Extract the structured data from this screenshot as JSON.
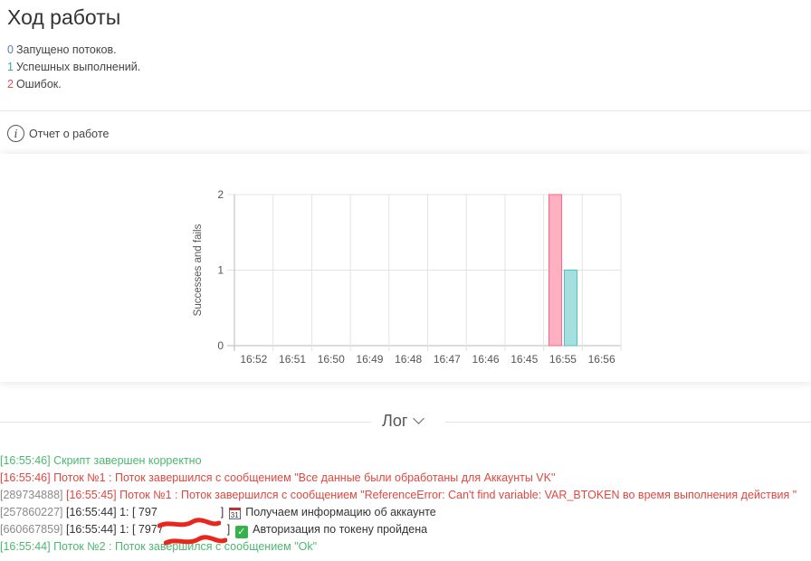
{
  "header": {
    "title": "Ход работы",
    "stats": [
      {
        "value": "0",
        "label": "Запущено потоков.",
        "color": "#5b7fb8"
      },
      {
        "value": "1",
        "label": "Успешных выполнений.",
        "color": "#3aa8a0"
      },
      {
        "value": "2",
        "label": "Ошибок.",
        "color": "#d9534f"
      }
    ],
    "report_link": "Отчет о работе"
  },
  "chart_data": {
    "type": "bar",
    "categories": [
      "16:52",
      "16:51",
      "16:50",
      "16:49",
      "16:48",
      "16:47",
      "16:46",
      "16:45",
      "16:55",
      "16:56"
    ],
    "series": [
      {
        "values": [
          0,
          0,
          0,
          0,
          0,
          0,
          0,
          0,
          2,
          0
        ],
        "color": "#ffb1c1",
        "stroke": "#ff6384"
      },
      {
        "values": [
          0,
          0,
          0,
          0,
          0,
          0,
          0,
          0,
          1,
          0
        ],
        "color": "#a5dfdf",
        "stroke": "#4bc0c0"
      }
    ],
    "ylabel": "Successes and fails",
    "yticks": [
      "0",
      "1",
      "2"
    ],
    "ylim": [
      0,
      2
    ],
    "grid": true
  },
  "log": {
    "title": "Лог",
    "entries": [
      {
        "parts": [
          {
            "text": "[16:55:46] Скрипт завершен корректно",
            "cls": "c-green"
          }
        ]
      },
      {
        "parts": [
          {
            "text": "[16:55:46] Поток №1 : Поток завершился с сообщением \"Все данные были обработаны для Аккаунты VK\"",
            "cls": "c-red"
          }
        ]
      },
      {
        "parts": [
          {
            "text": "[289734888] ",
            "cls": "c-gray"
          },
          {
            "text": "[16:55:45] Поток №1 : Поток завершился с сообщением \"ReferenceError: Can't find variable: VAR_BTOKEN во время выполнения действия \"",
            "cls": "c-red"
          }
        ]
      },
      {
        "parts": [
          {
            "text": "[257860227] ",
            "cls": "c-gray"
          },
          {
            "text": "[16:55:44] 1: [ 797",
            "cls": "c-dark"
          },
          {
            "redact": true,
            "text": "0000000 ",
            "cls": "c-dark"
          },
          {
            "text": "] ",
            "cls": "c-dark"
          },
          {
            "icon": "calendar-icon",
            "text": "31"
          },
          {
            "text": " Получаем информацию об аккаунте",
            "cls": "c-dark"
          }
        ]
      },
      {
        "parts": [
          {
            "text": "[660667859] ",
            "cls": "c-gray"
          },
          {
            "text": "[16:55:44] 1: [ 7977",
            "cls": "c-dark"
          },
          {
            "redact": true,
            "text": "0000000 ",
            "cls": "c-dark"
          },
          {
            "text": "] ",
            "cls": "c-dark"
          },
          {
            "icon": "checkmark-icon",
            "text": "✓"
          },
          {
            "text": " Авторизация по токену пройдена",
            "cls": "c-dark"
          }
        ]
      },
      {
        "parts": [
          {
            "text": "[16:55:44] Поток №2 : Поток завершился с сообщением \"Ok\"",
            "cls": "c-green"
          }
        ]
      }
    ]
  }
}
